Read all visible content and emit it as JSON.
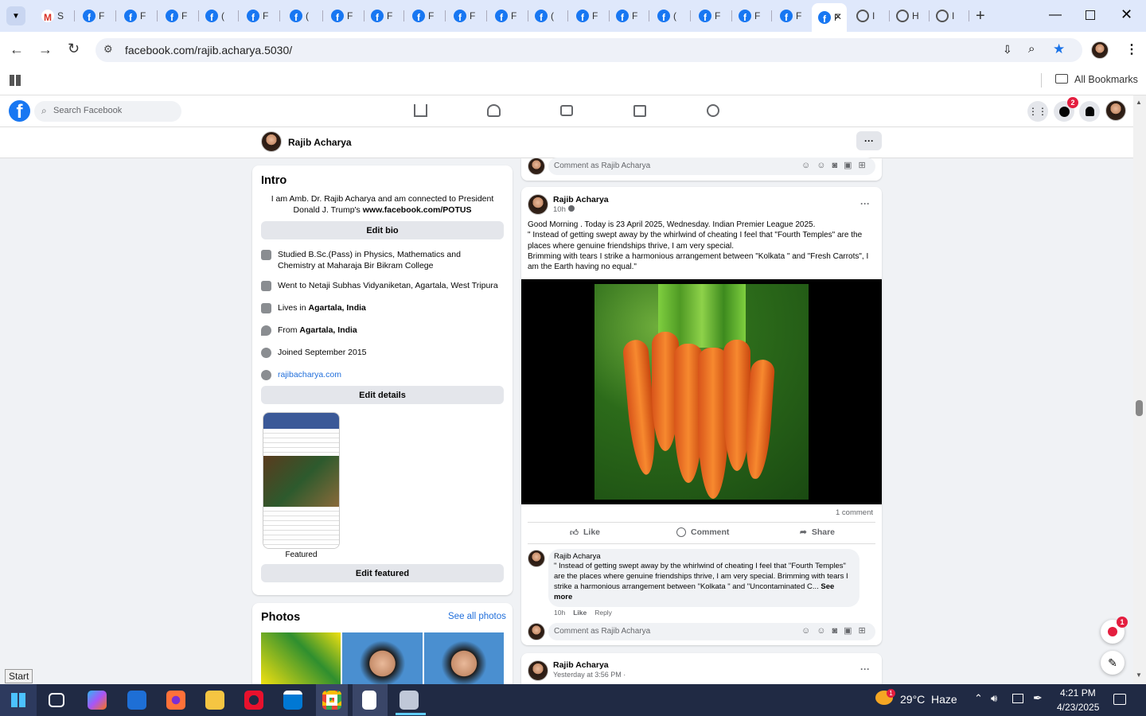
{
  "browser": {
    "tabs": [
      {
        "label": "S",
        "type": "gmail"
      },
      {
        "label": "F",
        "type": "facebook"
      },
      {
        "label": "F",
        "type": "facebook"
      },
      {
        "label": "F",
        "type": "facebook"
      },
      {
        "label": "(",
        "type": "facebook"
      },
      {
        "label": "F",
        "type": "facebook"
      },
      {
        "label": "(",
        "type": "facebook"
      },
      {
        "label": "F",
        "type": "facebook"
      },
      {
        "label": "F",
        "type": "facebook"
      },
      {
        "label": "F",
        "type": "facebook"
      },
      {
        "label": "F",
        "type": "facebook"
      },
      {
        "label": "F",
        "type": "facebook"
      },
      {
        "label": "(",
        "type": "facebook"
      },
      {
        "label": "F",
        "type": "facebook"
      },
      {
        "label": "F",
        "type": "facebook"
      },
      {
        "label": "(",
        "type": "facebook"
      },
      {
        "label": "F",
        "type": "facebook"
      },
      {
        "label": "F",
        "type": "facebook"
      },
      {
        "label": "F",
        "type": "facebook"
      },
      {
        "label": "F",
        "type": "facebook",
        "active": true
      },
      {
        "label": "I",
        "type": "globe"
      },
      {
        "label": "H",
        "type": "globe"
      },
      {
        "label": "I",
        "type": "globe"
      }
    ],
    "url": "facebook.com/rajib.acharya.5030/",
    "all_bookmarks": "All Bookmarks"
  },
  "fb": {
    "search_placeholder": "Search Facebook",
    "messenger_badge": "2",
    "profile_name": "Rajib Acharya",
    "more_button": "···"
  },
  "intro": {
    "title": "Intro",
    "bio_plain": "I am Amb. Dr. Rajib Acharya and am connected to President Donald J. Trump's ",
    "bio_link": "www.facebook.com/POTUS",
    "edit_bio": "Edit bio",
    "studied": "Studied B.Sc.(Pass) in Physics, Mathematics and Chemistry at Maharaja Bir Bikram College",
    "went_to": "Went to Netaji Subhas Vidyaniketan, Agartala, West Tripura",
    "lives_pre": "Lives in ",
    "lives_place": "Agartala, India",
    "from_pre": "From ",
    "from_place": "Agartala, India",
    "joined": "Joined September 2015",
    "website": "rajibacharya.com",
    "edit_details": "Edit details",
    "featured_label": "Featured",
    "edit_featured": "Edit featured"
  },
  "photos": {
    "title": "Photos",
    "see_all": "See all photos"
  },
  "composer": {
    "placeholder": "Comment as Rajib Acharya"
  },
  "post": {
    "author": "Rajib Acharya",
    "time": "10h ·",
    "line1": "Good Morning . Today is 23 April 2025, Wednesday. Indian Premier League 2025.",
    "line2": "\" Instead of getting swept away by the whirlwind of cheating I feel that \"Fourth Temples\" are the places where genuine friendships thrive, I am very special.",
    "line3": "Brimming with tears I strike a harmonious arrangement between \"Kolkata \" and \"Fresh Carrots\", I am the Earth having no equal.\"",
    "comments_count": "1 comment",
    "like": "Like",
    "comment": "Comment",
    "share": "Share",
    "c_author": "Rajib Acharya",
    "c_text": "\" Instead of getting swept away by the whirlwind of cheating I feel that \"Fourth Temples\" are the places where genuine friendships thrive, I am very special. Brimming with tears I strike a harmonious arrangement between \"Kolkata \" and \"Uncontaminated C... ",
    "c_see_more": "See more",
    "c_time": "10h",
    "c_like": "Like",
    "c_reply": "Reply"
  },
  "post2": {
    "author": "Rajib Acharya",
    "time": "Yesterday at 3:56 PM ·"
  },
  "notif_badge": "1",
  "tooltip": "Start",
  "taskbar": {
    "weather": "29°C",
    "condition": "Haze",
    "time": "4:21 PM",
    "date": "4/23/2025",
    "weather_badge": "1"
  },
  "colors": {
    "fb_blue": "#1877f2",
    "badge_red": "#e41e3f",
    "tab_bg": "#dfe8fb",
    "taskbar": "#202a44"
  }
}
